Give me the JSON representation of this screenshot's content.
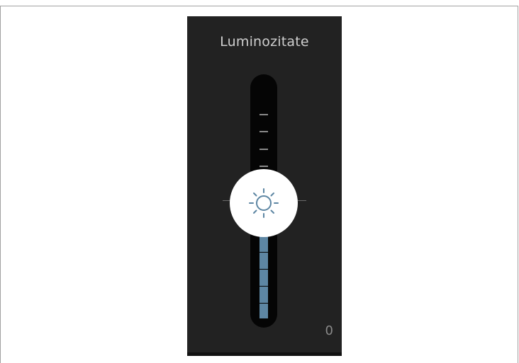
{
  "brightness_control": {
    "title": "Luminozitate",
    "value_readout": "0",
    "level": 0.5,
    "thumb_icon": "sun-icon",
    "colors": {
      "panel_background": "#222222",
      "track_background": "#050505",
      "fill": "#5d86a3",
      "thumb": "#ffffff",
      "icon": "#5d86a3",
      "text": "#cfcfcf"
    }
  }
}
